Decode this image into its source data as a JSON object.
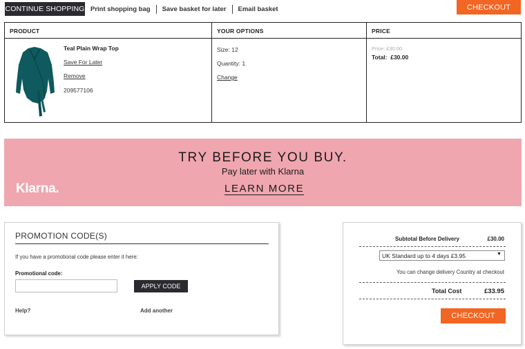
{
  "toolbar": {
    "continue_label": "CONTINUE SHOPPING",
    "links": [
      "Print shopping bag",
      "Save basket for later",
      "Email basket"
    ],
    "checkout_label": "CHECKOUT"
  },
  "table": {
    "headers": {
      "product": "PRODUCT",
      "options": "YOUR OPTIONS",
      "price": "PRICE"
    },
    "item": {
      "name": "Teal Plain Wrap Top",
      "save_label": "Save For Later",
      "remove_label": "Remove",
      "sku": "209577106",
      "size": "Size: 12",
      "quantity": "Quantity: 1",
      "change_label": "Change",
      "price_was": "Price: £30.00",
      "total": "Total:  £30.00"
    }
  },
  "klarna": {
    "headline": "TRY BEFORE YOU BUY.",
    "subline": "Pay later with Klarna",
    "cta": "LEARN MORE",
    "logo": "Klarna."
  },
  "promo": {
    "title": "PROMOTION CODE(S)",
    "intro": "If you have a promotional code please enter it here:",
    "label": "Promotional code:",
    "input_value": "",
    "apply_label": "APPLY CODE",
    "help_label": "Help?",
    "add_label": "Add another"
  },
  "summary": {
    "subtotal_label": "Subtotal Before Delivery",
    "subtotal_value": "£30.00",
    "delivery_selected": "UK Standard up to 4 days £3.95",
    "note": "You can change delivery Country at checkout",
    "total_label": "Total Cost",
    "total_value": "£33.95",
    "checkout_label": "CHECKOUT"
  },
  "colors": {
    "accent": "#f26522",
    "dark": "#2a2a30",
    "klarna_pink": "#f0a6af",
    "product_teal": "#0e5a5e"
  }
}
